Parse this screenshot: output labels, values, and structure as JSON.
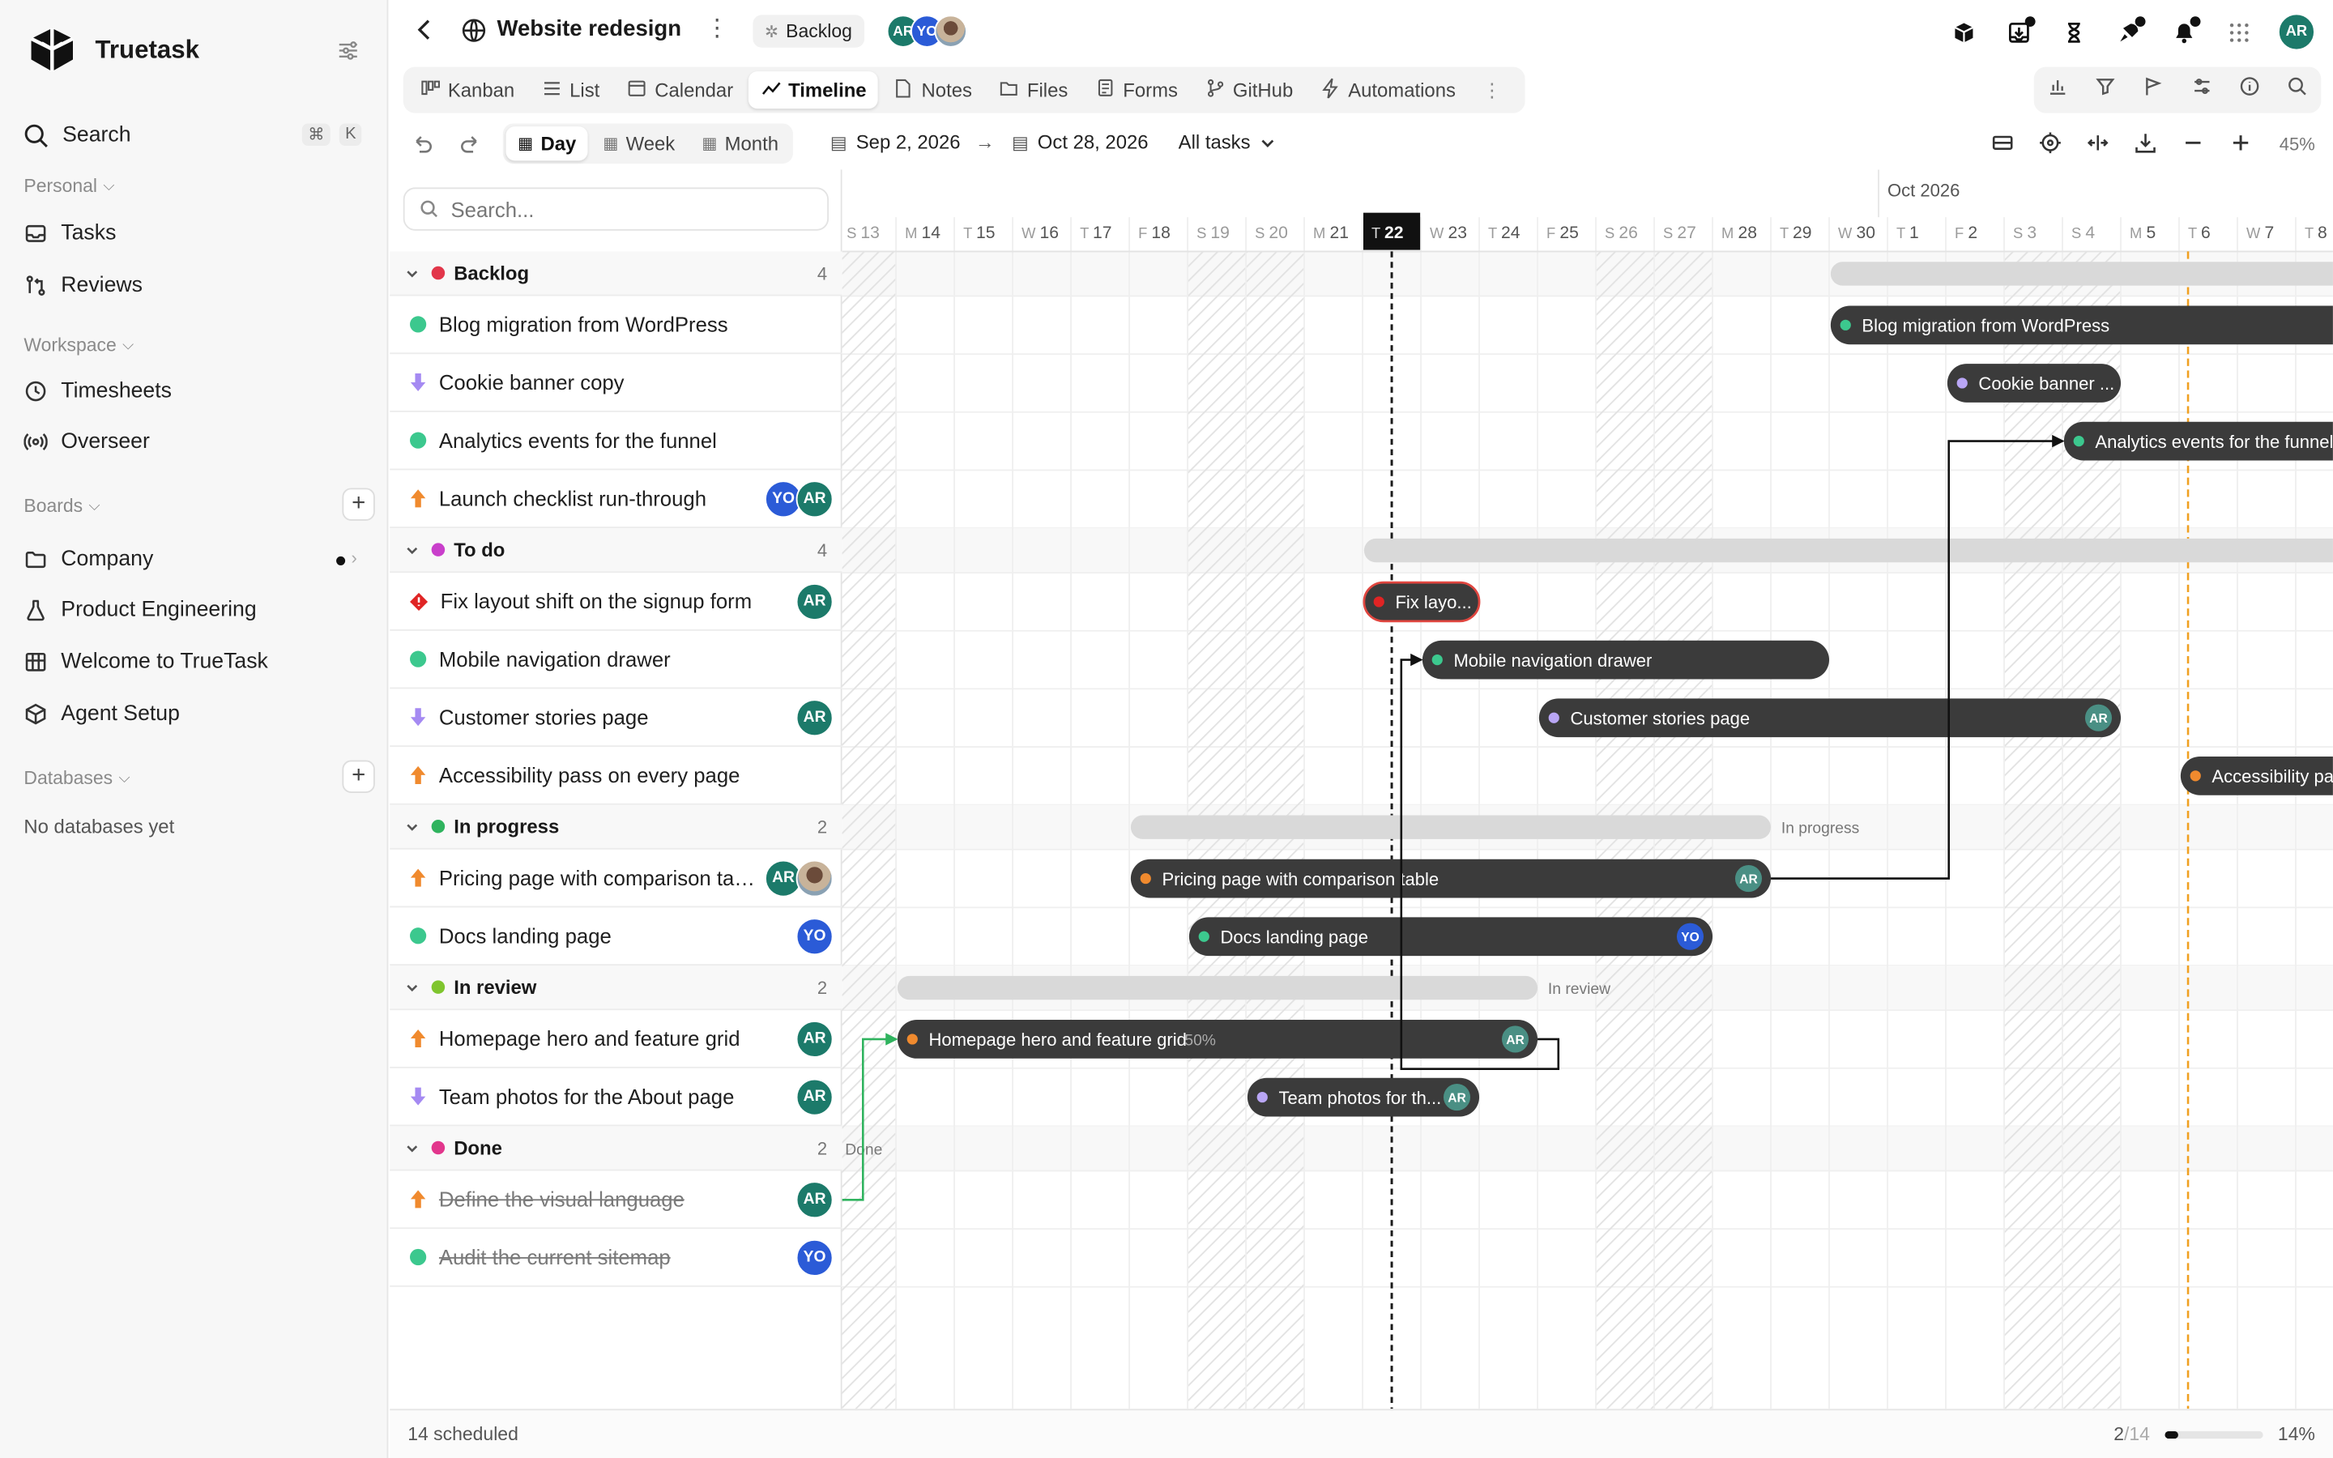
{
  "app": {
    "name": "Truetask"
  },
  "sidebar": {
    "search_label": "Search",
    "search_shortcut": [
      "⌘",
      "K"
    ],
    "personal_section": "Personal",
    "personal_items": [
      {
        "label": "Tasks",
        "icon": "inbox-icon"
      },
      {
        "label": "Reviews",
        "icon": "git-compare-icon"
      }
    ],
    "workspace_section": "Workspace",
    "workspace_items": [
      {
        "label": "Timesheets",
        "icon": "timer-icon"
      },
      {
        "label": "Overseer",
        "icon": "radio-icon"
      }
    ],
    "boards_section": "Boards",
    "boards_items": [
      {
        "label": "Company",
        "icon": "folder-icon"
      },
      {
        "label": "Product Engineering",
        "icon": "flask-icon"
      },
      {
        "label": "Welcome to TrueTask",
        "icon": "board-icon"
      },
      {
        "label": "Agent Setup",
        "icon": "cube-icon"
      }
    ],
    "databases_section": "Databases",
    "databases_empty": "No databases yet"
  },
  "header": {
    "project_title": "Website redesign",
    "status_chip": "Backlog",
    "members": [
      "AR",
      "YO",
      ""
    ],
    "user_avatar": "AR"
  },
  "view_tabs": [
    {
      "label": "Kanban",
      "icon": "kanban-icon"
    },
    {
      "label": "List",
      "icon": "list-icon"
    },
    {
      "label": "Calendar",
      "icon": "calendar-icon"
    },
    {
      "label": "Timeline",
      "icon": "timeline-icon",
      "active": true
    },
    {
      "label": "Notes",
      "icon": "note-icon"
    },
    {
      "label": "Files",
      "icon": "folder-icon"
    },
    {
      "label": "Forms",
      "icon": "form-icon"
    },
    {
      "label": "GitHub",
      "icon": "github-icon"
    },
    {
      "label": "Automations",
      "icon": "bolt-icon"
    }
  ],
  "toolbar": {
    "scale_options": [
      "Day",
      "Week",
      "Month"
    ],
    "active_scale": "Day",
    "start_date": "Sep 2, 2026",
    "arrow": "→",
    "end_date": "Oct 28, 2026",
    "filter": "All tasks",
    "zoom": "45%"
  },
  "list": {
    "search_placeholder": "Search...",
    "groups": [
      {
        "name": "Backlog",
        "count": "4",
        "color": "#e2364a",
        "tasks": [
          {
            "name": "Blog migration from WordPress",
            "icon": "dot-icon",
            "icon_color": "#3cc88e",
            "avatars": []
          },
          {
            "name": "Cookie banner copy",
            "icon": "arrow-down-icon",
            "icon_color": "#a58af2",
            "avatars": []
          },
          {
            "name": "Analytics events for the funnel",
            "icon": "dot-icon",
            "icon_color": "#3cc88e",
            "avatars": []
          },
          {
            "name": "Launch checklist run-through",
            "icon": "arrow-up-icon",
            "icon_color": "#f08a2e",
            "avatars": [
              "YO",
              "AR"
            ]
          }
        ]
      },
      {
        "name": "To do",
        "count": "4",
        "color": "#c93fcb",
        "tasks": [
          {
            "name": "Fix layout shift on the signup form",
            "icon": "urgent-icon",
            "icon_color": "#e02424",
            "avatars": [
              "AR"
            ]
          },
          {
            "name": "Mobile navigation drawer",
            "icon": "dot-icon",
            "icon_color": "#3cc88e",
            "avatars": []
          },
          {
            "name": "Customer stories page",
            "icon": "arrow-down-icon",
            "icon_color": "#a58af2",
            "avatars": [
              "AR"
            ]
          },
          {
            "name": "Accessibility pass on every page",
            "icon": "arrow-up-icon",
            "icon_color": "#f08a2e",
            "avatars": []
          }
        ]
      },
      {
        "name": "In progress",
        "count": "2",
        "color": "#2fb35e",
        "tasks": [
          {
            "name": "Pricing page with comparison table",
            "icon": "arrow-up-icon",
            "icon_color": "#f08a2e",
            "avatars": [
              "AR",
              ""
            ]
          },
          {
            "name": "Docs landing page",
            "icon": "dot-icon",
            "icon_color": "#3cc88e",
            "avatars": [
              "YO"
            ]
          }
        ]
      },
      {
        "name": "In review",
        "count": "2",
        "color": "#7fc52e",
        "tasks": [
          {
            "name": "Homepage hero and feature grid",
            "icon": "arrow-up-icon",
            "icon_color": "#f08a2e",
            "avatars": [
              "AR"
            ]
          },
          {
            "name": "Team photos for the About page",
            "icon": "arrow-down-icon",
            "icon_color": "#a58af2",
            "avatars": [
              "AR"
            ]
          }
        ]
      },
      {
        "name": "Done",
        "count": "2",
        "color": "#e2368c",
        "tasks": [
          {
            "name": "Define the visual language",
            "icon": "arrow-up-icon",
            "icon_color": "#f08a2e",
            "avatars": [
              "AR"
            ],
            "done": true
          },
          {
            "name": "Audit the current sitemap",
            "icon": "dot-icon",
            "icon_color": "#3cc88e",
            "avatars": [
              "YO"
            ],
            "done": true
          }
        ]
      }
    ]
  },
  "timeline": {
    "month_label": "Oct 2026",
    "days": [
      {
        "dow": "S",
        "d": "13",
        "weekend": true
      },
      {
        "dow": "M",
        "d": "14"
      },
      {
        "dow": "T",
        "d": "15"
      },
      {
        "dow": "W",
        "d": "16"
      },
      {
        "dow": "T",
        "d": "17"
      },
      {
        "dow": "F",
        "d": "18"
      },
      {
        "dow": "S",
        "d": "19",
        "weekend": true
      },
      {
        "dow": "S",
        "d": "20",
        "weekend": true
      },
      {
        "dow": "M",
        "d": "21"
      },
      {
        "dow": "T",
        "d": "22",
        "today": true
      },
      {
        "dow": "W",
        "d": "23"
      },
      {
        "dow": "T",
        "d": "24"
      },
      {
        "dow": "F",
        "d": "25"
      },
      {
        "dow": "S",
        "d": "26",
        "weekend": true
      },
      {
        "dow": "S",
        "d": "27",
        "weekend": true
      },
      {
        "dow": "M",
        "d": "28"
      },
      {
        "dow": "T",
        "d": "29"
      },
      {
        "dow": "W",
        "d": "30"
      },
      {
        "dow": "T",
        "d": "1"
      },
      {
        "dow": "F",
        "d": "2"
      },
      {
        "dow": "S",
        "d": "3",
        "weekend": true
      },
      {
        "dow": "S",
        "d": "4",
        "weekend": true
      },
      {
        "dow": "M",
        "d": "5"
      },
      {
        "dow": "T",
        "d": "6"
      },
      {
        "dow": "W",
        "d": "7"
      },
      {
        "dow": "T",
        "d": "8"
      }
    ],
    "bars": [
      {
        "label": "Blog migration from WordPress",
        "dot": "#3cc88e",
        "avatar": ""
      },
      {
        "label": "Cookie banner ...",
        "dot": "#b9a6f5",
        "avatar": ""
      },
      {
        "label": "Analytics events for the funnel",
        "dot": "#3cc88e",
        "avatar": ""
      },
      {
        "label": "Fix layo...",
        "dot": "#e02424",
        "avatar": ""
      },
      {
        "label": "Mobile navigation drawer",
        "dot": "#3cc88e",
        "avatar": ""
      },
      {
        "label": "Customer stories page",
        "dot": "#b9a6f5",
        "avatar": "AR"
      },
      {
        "label": "Accessibility pa",
        "dot": "#f08a2e",
        "avatar": ""
      },
      {
        "label": "Pricing page with comparison table",
        "dot": "#f08a2e",
        "avatar": "AR"
      },
      {
        "label": "Docs landing page",
        "dot": "#3cc88e",
        "avatar": "YO"
      },
      {
        "label": "Homepage hero and feature grid",
        "dot": "#f08a2e",
        "avatar": "AR",
        "progress": "50%"
      },
      {
        "label": "Team photos for th...",
        "dot": "#b9a6f5",
        "avatar": "AR"
      }
    ],
    "group_labels": [
      "In progress",
      "In review",
      "Done"
    ]
  },
  "footer": {
    "scheduled": "14 scheduled",
    "done_count": "2",
    "total_count": "/14",
    "progress": 0.14,
    "progress_label": "14%"
  },
  "colors": {
    "accent": "#111111",
    "today_line": "#1a1a1a",
    "deadline_line": "#f0a020",
    "bar": "#3b3b3b",
    "summary_bar": "#d9d9d9",
    "dependency_done": "#2fb35e"
  }
}
